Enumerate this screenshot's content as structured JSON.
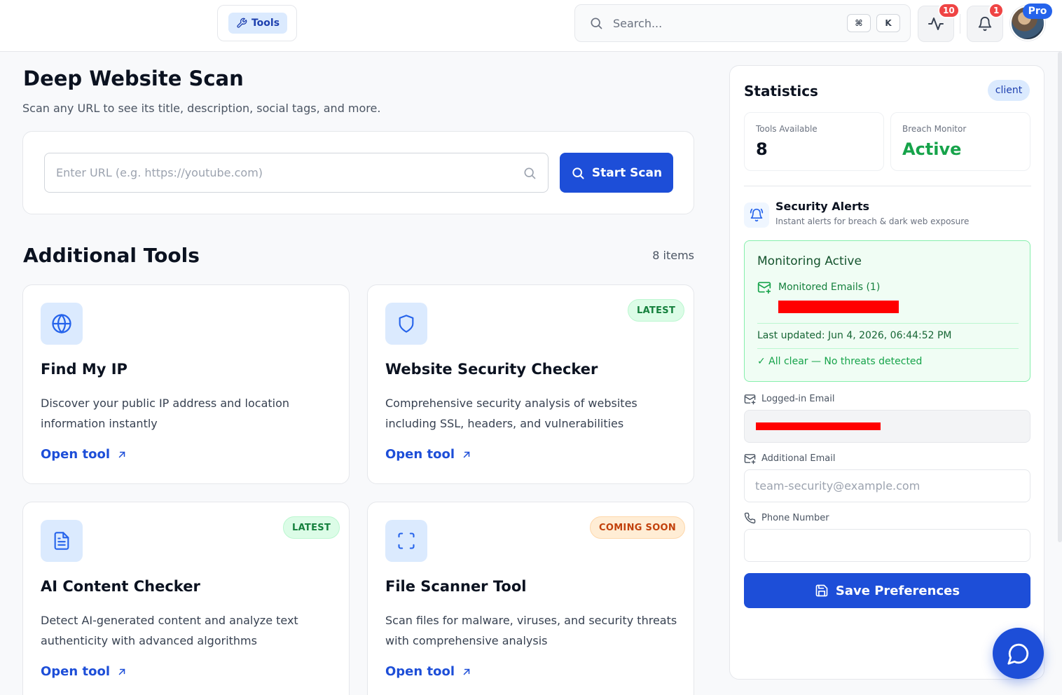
{
  "topbar": {
    "tools_label": "Tools",
    "search_placeholder": "Search...",
    "shortcut_keys": [
      "⌘",
      "K"
    ],
    "activity_badge": "10",
    "notification_badge": "1",
    "pro_label": "Pro"
  },
  "scan": {
    "title": "Deep Website Scan",
    "subtitle": "Scan any URL to see its title, description, social tags, and more.",
    "url_placeholder": "Enter URL (e.g. https://youtube.com)",
    "button_label": "Start Scan"
  },
  "additional": {
    "title": "Additional Tools",
    "count_label": "8 items",
    "tools": [
      {
        "icon": "globe-icon",
        "title": "Find My IP",
        "description": "Discover your public IP address and location information instantly",
        "link": "Open tool",
        "tag": ""
      },
      {
        "icon": "shield-icon",
        "title": "Website Security Checker",
        "description": "Comprehensive security analysis of websites including SSL, headers, and vulnerabilities",
        "link": "Open tool",
        "tag": "LATEST"
      },
      {
        "icon": "document-icon",
        "title": "AI Content Checker",
        "description": "Detect AI-generated content and analyze text authenticity with advanced algorithms",
        "link": "Open tool",
        "tag": "LATEST"
      },
      {
        "icon": "scan-frame-icon",
        "title": "File Scanner Tool",
        "description": "Scan files for malware, viruses, and security threats with comprehensive analysis",
        "link": "Open tool",
        "tag": "COMING SOON"
      }
    ]
  },
  "stats": {
    "title": "Statistics",
    "role_badge": "client",
    "tools_available_label": "Tools Available",
    "tools_available_value": "8",
    "breach_monitor_label": "Breach Monitor",
    "breach_monitor_value": "Active"
  },
  "alerts": {
    "title": "Security Alerts",
    "subtitle": "Instant alerts for breach & dark web exposure",
    "monitoring_title": "Monitoring Active",
    "monitored_emails": "Monitored Emails (1)",
    "last_updated": "Last updated: Jun 4, 2026, 06:44:52 PM",
    "status": "✓ All clear — No threats detected"
  },
  "form": {
    "logged_in_label": "Logged-in Email",
    "additional_label": "Additional Email",
    "additional_placeholder": "team-security@example.com",
    "phone_label": "Phone Number",
    "phone_value": "",
    "save_label": "Save Preferences"
  },
  "colors": {
    "accent": "#1d4ed8",
    "success": "#16a34a",
    "warning": "#c2410c",
    "danger": "#ef4444"
  }
}
